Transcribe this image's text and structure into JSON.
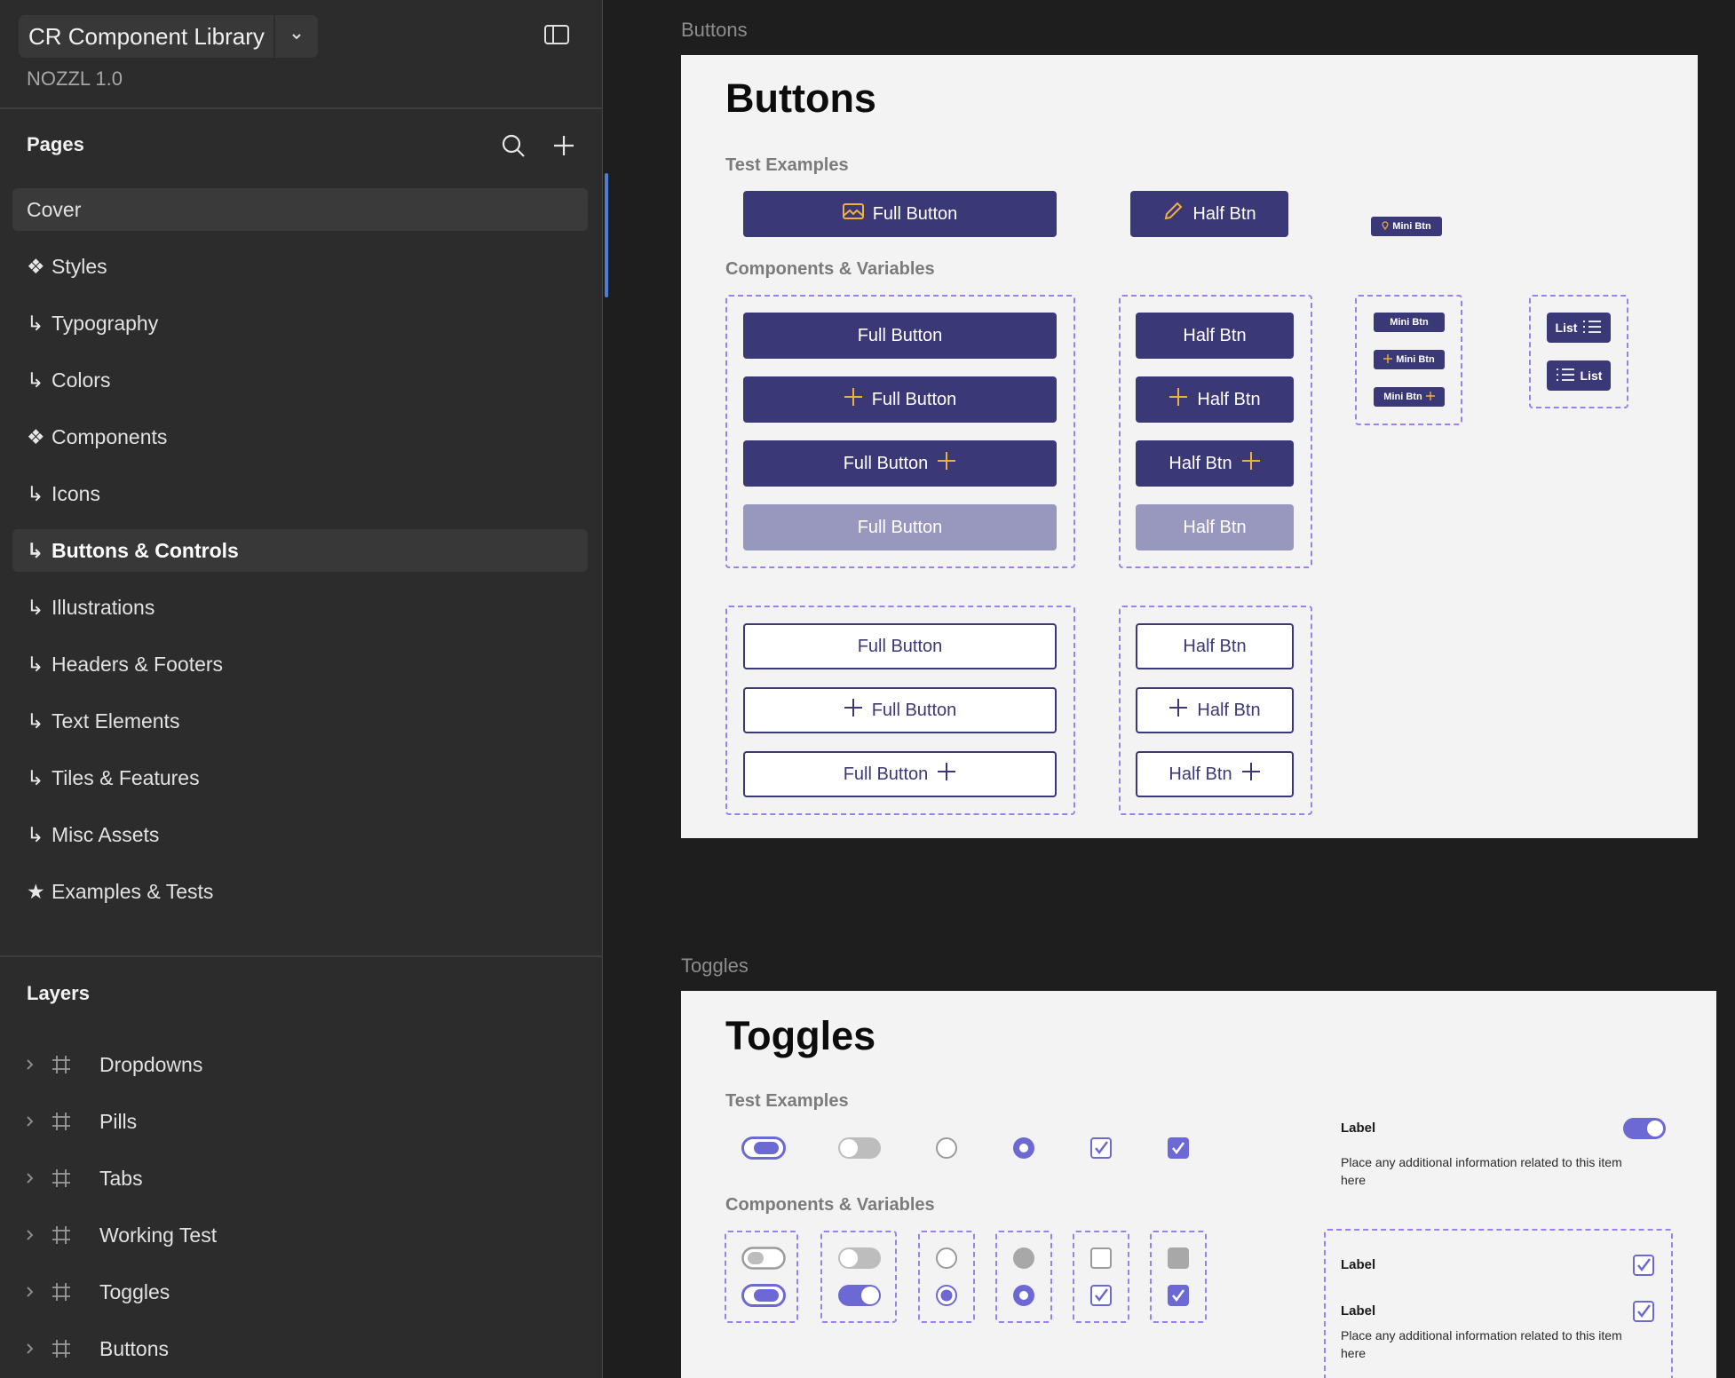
{
  "file": {
    "name": "CR Component Library",
    "version": "NOZZL 1.0"
  },
  "pages": {
    "title": "Pages",
    "items": [
      {
        "glyph": "",
        "label": "Cover"
      },
      {
        "glyph": "❖",
        "label": "Styles"
      },
      {
        "glyph": "↳",
        "label": "Typography"
      },
      {
        "glyph": "↳",
        "label": "Colors"
      },
      {
        "glyph": "❖",
        "label": "Components"
      },
      {
        "glyph": "↳",
        "label": "Icons"
      },
      {
        "glyph": "↳",
        "label": "Buttons & Controls"
      },
      {
        "glyph": "↳",
        "label": "Illustrations"
      },
      {
        "glyph": "↳",
        "label": "Headers & Footers"
      },
      {
        "glyph": "↳",
        "label": "Text Elements"
      },
      {
        "glyph": "↳",
        "label": "Tiles & Features"
      },
      {
        "glyph": "↳",
        "label": "Misc Assets"
      },
      {
        "glyph": "★",
        "label": "Examples & Tests"
      }
    ]
  },
  "layers": {
    "title": "Layers",
    "items": [
      {
        "label": "Dropdowns"
      },
      {
        "label": "Pills"
      },
      {
        "label": "Tabs"
      },
      {
        "label": "Working Test"
      },
      {
        "label": "Toggles"
      },
      {
        "label": "Buttons"
      }
    ]
  },
  "buttons_frame": {
    "label": "Buttons",
    "title": "Buttons",
    "test_examples": "Test Examples",
    "components_variables": "Components & Variables",
    "full_button": "Full Button",
    "half_btn": "Half Btn",
    "mini_btn": "Mini Btn",
    "list": "List"
  },
  "toggles_frame": {
    "label": "Toggles",
    "title": "Toggles",
    "test_examples": "Test Examples",
    "components_variables": "Components & Variables",
    "item_label": "Label",
    "item_info": "Place any additional information related to this item here"
  },
  "colors": {
    "primary": "#3b3878",
    "accent": "#f0b040",
    "toggle": "#6c69d4",
    "dash": "#9a82ee"
  }
}
